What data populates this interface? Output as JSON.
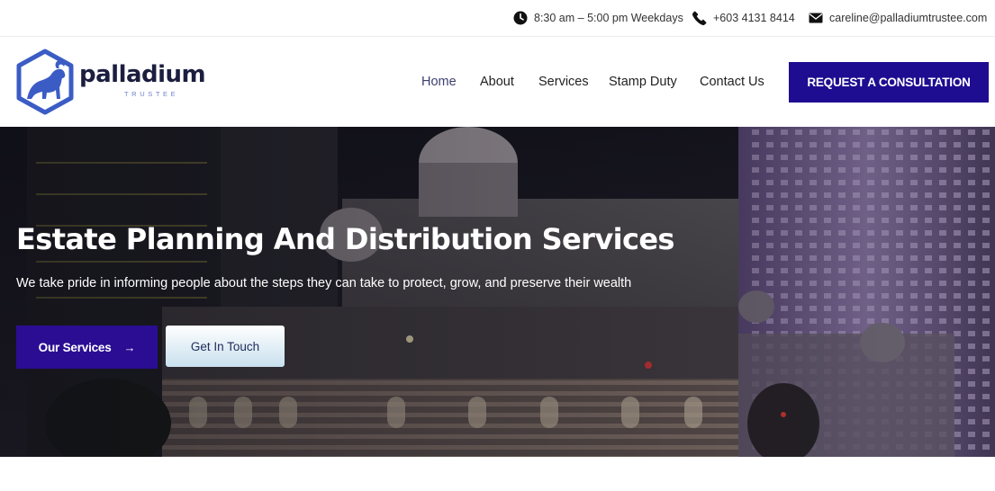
{
  "topbar": {
    "hours": "8:30 am – 5:00 pm Weekdays",
    "phone": "+603 4131 8414",
    "email": "careline@palladiumtrustee.com",
    "icons": [
      "clock-icon",
      "phone-icon",
      "envelope-icon"
    ]
  },
  "logo": {
    "word": "palladium",
    "sub": "TRUSTEE"
  },
  "nav": {
    "items": [
      {
        "label": "Home",
        "active": true
      },
      {
        "label": "About"
      },
      {
        "label": "Services"
      },
      {
        "label": "Stamp Duty"
      },
      {
        "label": "Contact Us"
      }
    ],
    "cta": "REQUEST A CONSULTATION"
  },
  "hero": {
    "title": "Estate Planning And Distribution Services",
    "subtitle": "We take pride in informing people about the steps they can take to protect, grow, and preserve their wealth",
    "primary_button": "Our Services",
    "primary_arrow": "→",
    "secondary_button": "Get In Touch"
  },
  "colors": {
    "brand_navy": "#1e0d91",
    "logo_blue": "#3b5cc4",
    "text_dark": "#1c1e3f"
  }
}
